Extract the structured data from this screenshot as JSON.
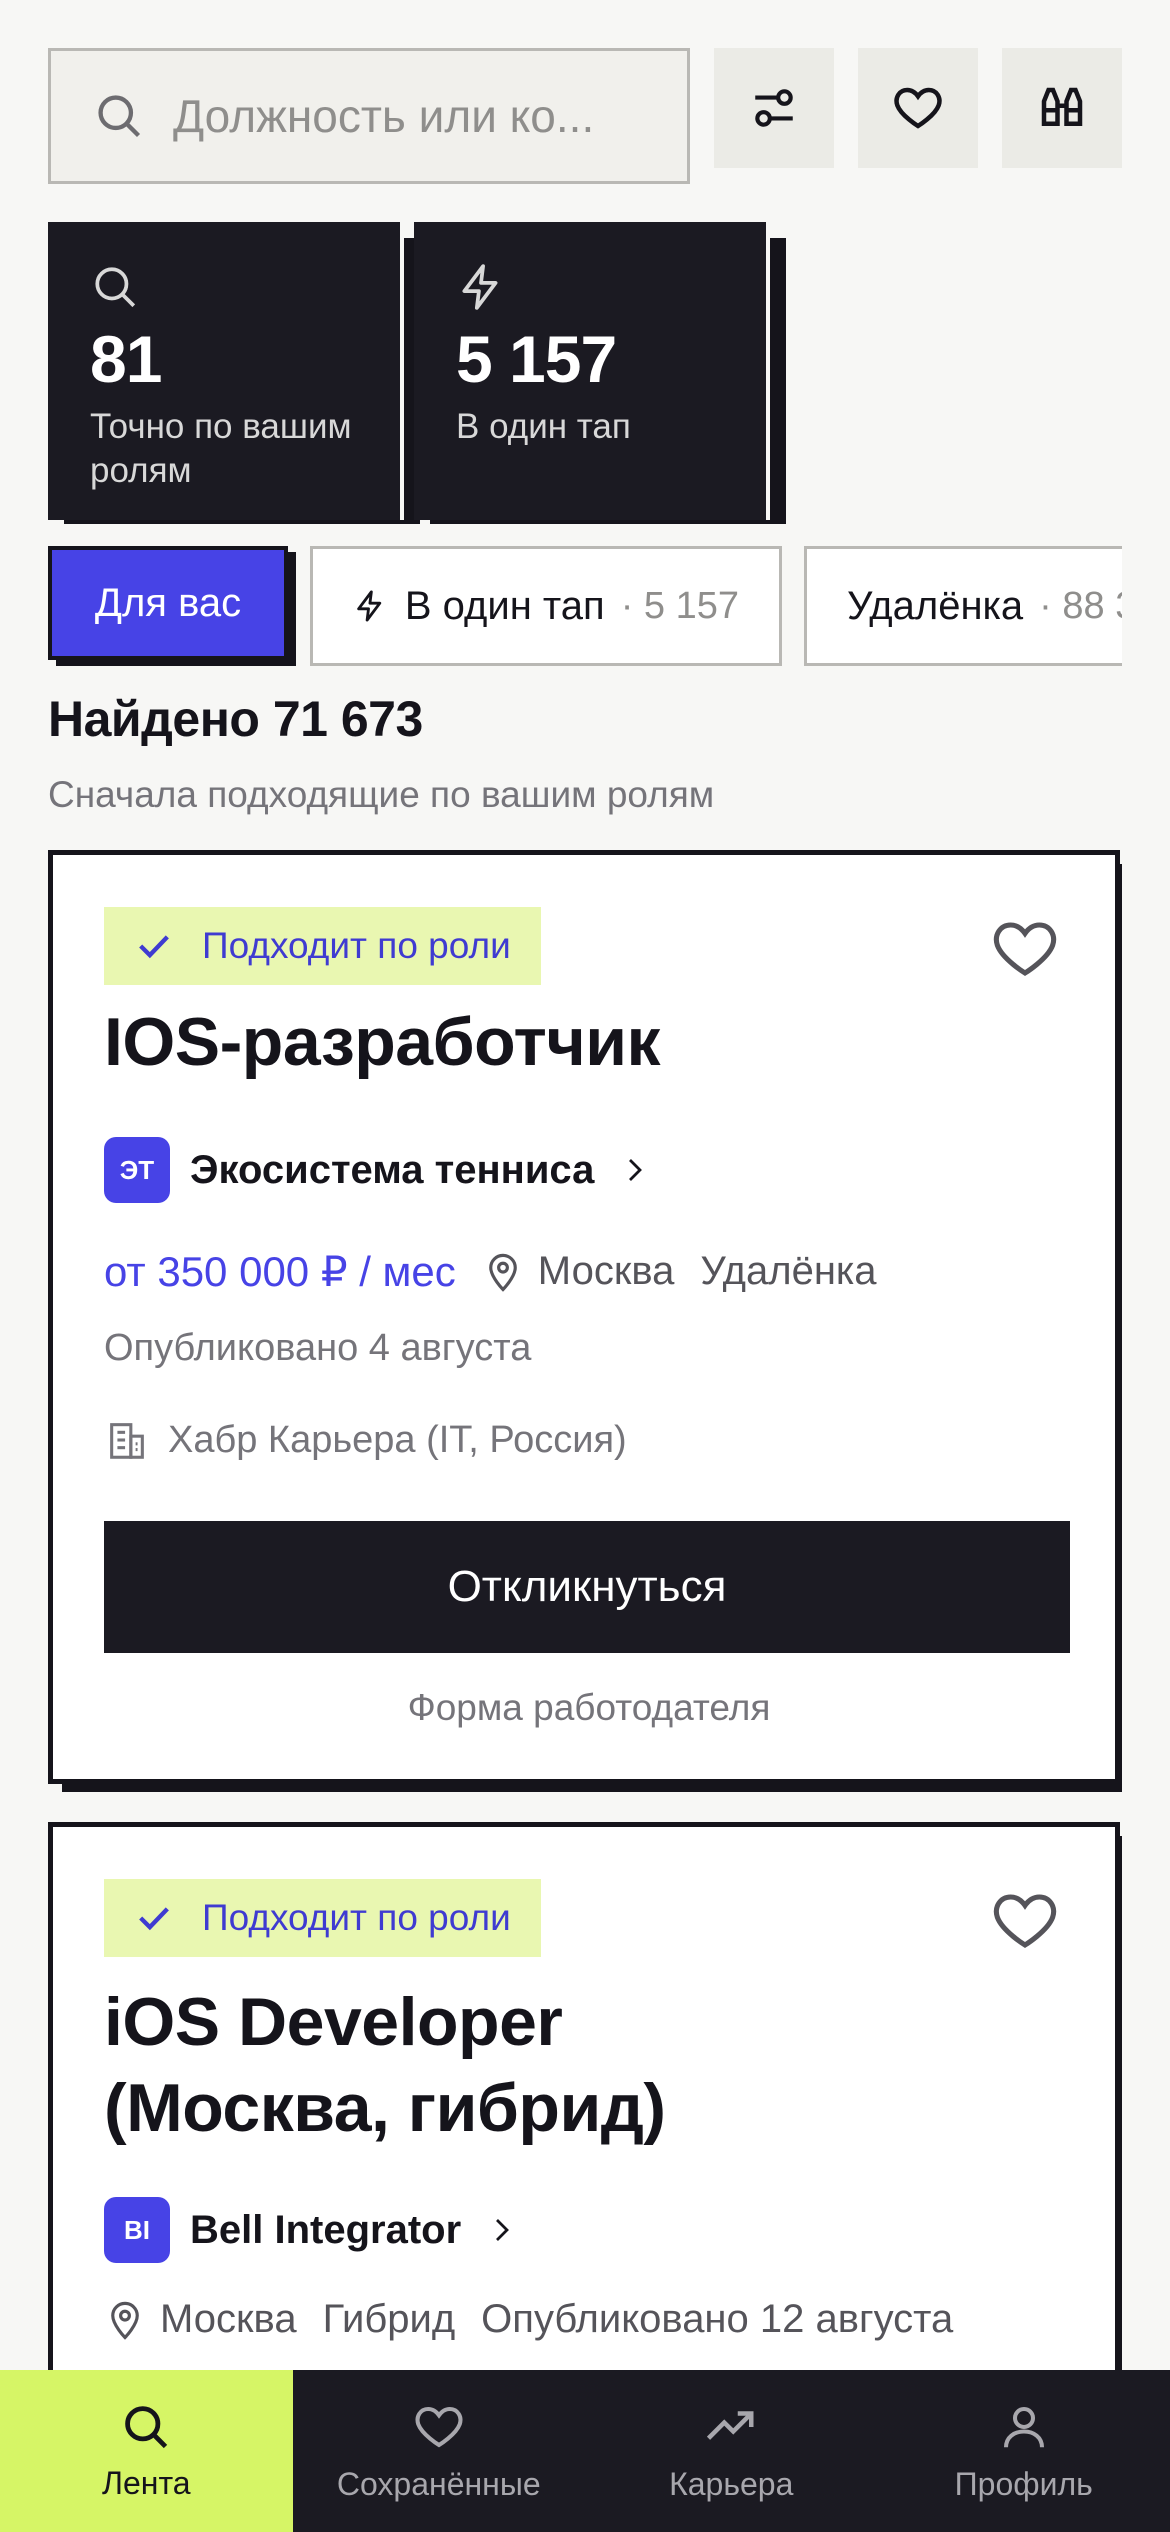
{
  "search": {
    "placeholder": "Должность или ко..."
  },
  "stats": [
    {
      "icon": "search-icon",
      "value": "81",
      "label": "Точно по вашим ролям"
    },
    {
      "icon": "lightning-icon",
      "value": "5 157",
      "label": "В один тап"
    }
  ],
  "chips": [
    {
      "label": "Для вас",
      "count": ""
    },
    {
      "label": "В один тап",
      "count": "· 5 157"
    },
    {
      "label": "Удалёнка",
      "count": "· 88 3"
    }
  ],
  "results": {
    "found": "Найдено 71 673",
    "sort_note": "Сначала подходящие по вашим ролям"
  },
  "vacancies": [
    {
      "badge": "Подходит по роли",
      "title": "IOS-разработчик",
      "company_initials": "ЭТ",
      "company": "Экосистема тенниса",
      "salary": "от 350 000 ₽ / мес",
      "city": "Москва",
      "work_format": "Удалёнка",
      "published": "Опубликовано 4 августа",
      "source": "Хабр Карьера (IT, Россия)",
      "apply_label": "Откликнуться",
      "form_note": "Форма работодателя"
    },
    {
      "badge": "Подходит по роли",
      "title_line1": "iOS Developer",
      "title_line2": "(Москва, гибрид)",
      "company_initials": "BI",
      "company": "Bell Integrator",
      "city": "Москва",
      "work_format": "Гибрид",
      "published": "Опубликовано 12 августа"
    }
  ],
  "nav": [
    {
      "label": "Лента",
      "icon": "search-icon",
      "active": true
    },
    {
      "label": "Сохранённые",
      "icon": "heart-icon",
      "active": false
    },
    {
      "label": "Карьера",
      "icon": "trend-up-icon",
      "active": false
    },
    {
      "label": "Профиль",
      "icon": "user-icon",
      "active": false
    }
  ],
  "colors": {
    "accent": "#4743e6",
    "dark": "#1b1a22",
    "lime": "#d6f566",
    "badge_bg": "#e9f7b1"
  }
}
